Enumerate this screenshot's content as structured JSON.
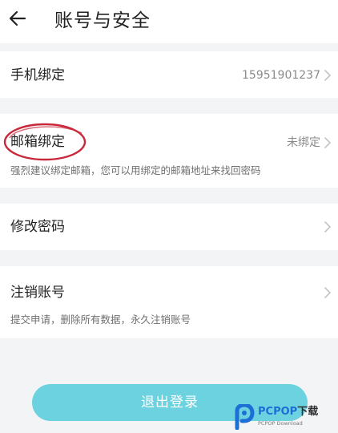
{
  "header": {
    "title": "账号与安全",
    "back_icon": "arrow-left-icon"
  },
  "rows": {
    "phone": {
      "title": "手机绑定",
      "value": "15951901237"
    },
    "email": {
      "title": "邮箱绑定",
      "value": "未绑定",
      "subtitle": "强烈建议绑定邮箱，您可以用绑定的邮箱地址来找回密码"
    },
    "password": {
      "title": "修改密码"
    },
    "deactivate": {
      "title": "注销账号",
      "subtitle": "提交申请，删除所有数据，永久注销账号"
    }
  },
  "logout": {
    "label": "退出登录"
  },
  "watermark": {
    "brand_a": "PCPOP",
    "brand_b": "下载",
    "sub": "PCPOP Download"
  },
  "colors": {
    "background": "#f3f4f6",
    "accent": "#6dd2df",
    "annotation_circle": "#c8283a",
    "watermark_blue": "#1d6fd6"
  }
}
